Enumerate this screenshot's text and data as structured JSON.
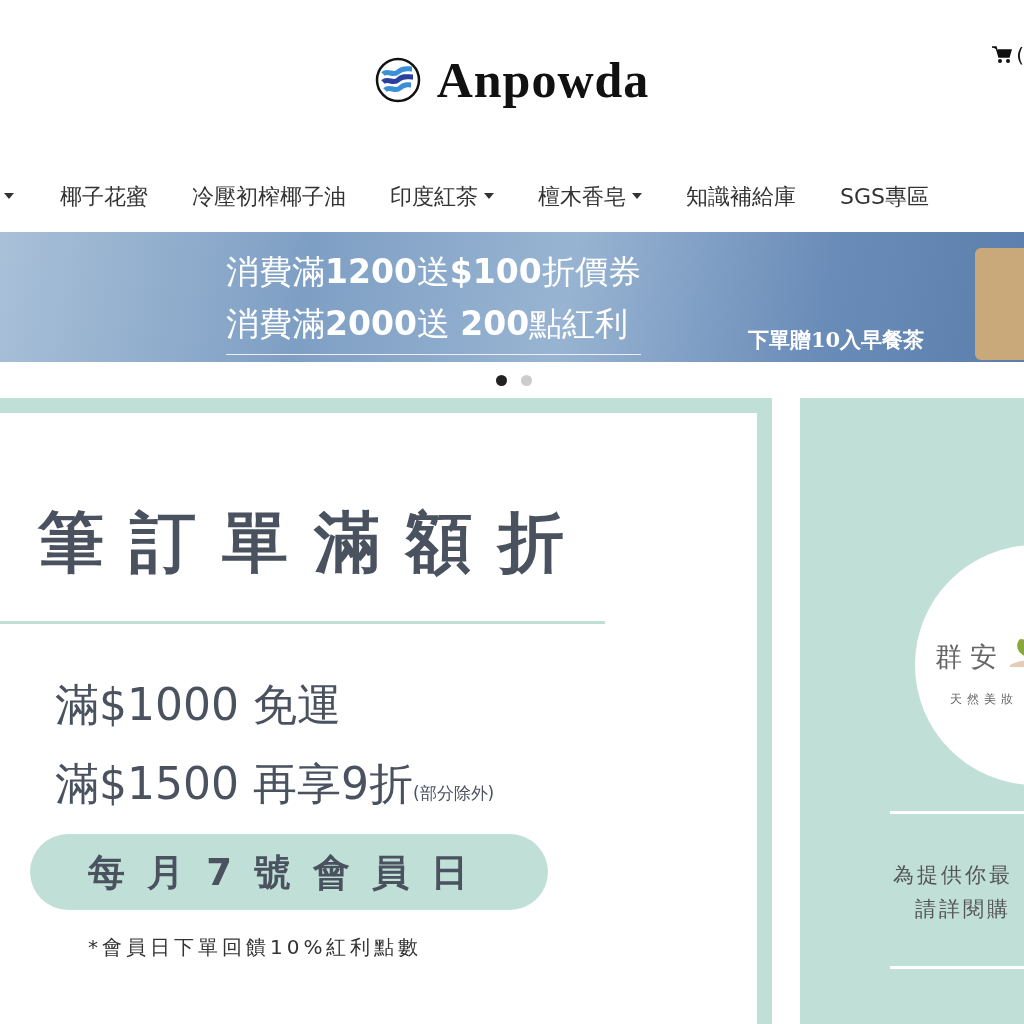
{
  "header": {
    "logo_text": "Anpowda",
    "cart_text": "("
  },
  "nav": {
    "items": [
      {
        "kind": "caret",
        "dropdown": true
      },
      {
        "kind": "link",
        "label": "椰子花蜜",
        "dropdown": false
      },
      {
        "kind": "link",
        "label": "冷壓初榨椰子油",
        "dropdown": false
      },
      {
        "kind": "link",
        "label": "印度紅茶",
        "dropdown": true
      },
      {
        "kind": "link",
        "label": "檀木香皂",
        "dropdown": true
      },
      {
        "kind": "link",
        "label": "知識補給庫",
        "dropdown": false
      },
      {
        "kind": "link",
        "label": "SGS專區",
        "dropdown": false
      }
    ]
  },
  "banner": {
    "lines": [
      "消費滿**1200**送**$100**折價券",
      "消費滿**2000**送 **200**點紅利"
    ],
    "gift_text": "下單贈10入早餐茶",
    "indicators": [
      {
        "selected": true
      },
      {
        "selected": false
      }
    ]
  },
  "promo": {
    "headline": "筆訂單滿額折",
    "offers": [
      {
        "text": "滿$1000 免運"
      },
      {
        "text": "滿$1500 再享9折",
        "note": "(部分除外)"
      }
    ],
    "member_day": "每月7號會員日",
    "footnote": "*會員日下單回饋10%紅利點數"
  },
  "side": {
    "logo_text": "群安",
    "logo_subtext": "天然美妝",
    "notice_lines": [
      "為提供你最",
      "請詳閱購"
    ]
  }
}
